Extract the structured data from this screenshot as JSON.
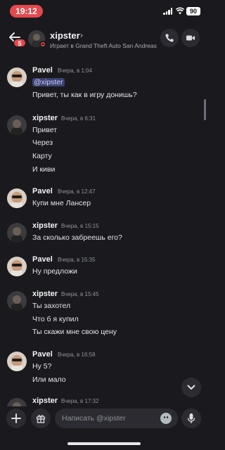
{
  "status_bar": {
    "time": "19:12",
    "battery": "90"
  },
  "header": {
    "back_badge": "5",
    "username": "xipster",
    "chevron": "›",
    "activity": "Играет в Grand Theft Auto San Andreas"
  },
  "messages": [
    {
      "author": "Pavel",
      "time": "Вчера, в 1:04",
      "mention": "@xipster",
      "lines": [
        "Привет, ты как в игру донишь?"
      ]
    },
    {
      "author": "xipster",
      "time": "Вчера, в 6:31",
      "lines": [
        "Привет",
        "Через",
        "Карту",
        "И киви"
      ]
    },
    {
      "author": "Pavel",
      "time": "Вчера, в 12:47",
      "lines": [
        "Купи мне Лансер"
      ]
    },
    {
      "author": "xipster",
      "time": "Вчера, в 15:15",
      "lines": [
        "За сколько забреешь его?"
      ]
    },
    {
      "author": "Pavel",
      "time": "Вчера, в 15:35",
      "lines": [
        "Ну предложи"
      ]
    },
    {
      "author": "xipster",
      "time": "Вчера, в 15:45",
      "lines": [
        "Ты захотел",
        "Что б я купил",
        "Ты скажи мне свою цену"
      ]
    },
    {
      "author": "Pavel",
      "time": "Вчера, в 16:58",
      "lines": [
        "Ну 5?",
        "Или мало"
      ]
    },
    {
      "author": "xipster",
      "time": "Вчера, в 17:32",
      "lines": []
    }
  ],
  "input": {
    "placeholder": "Написать @xipster"
  },
  "icons": {
    "back": "arrow-left-icon",
    "call": "phone-icon",
    "video": "video-camera-icon",
    "jump": "chevron-down-icon",
    "add": "plus-icon",
    "gift": "gift-icon",
    "emoji": "smile-icon",
    "mic": "microphone-icon"
  },
  "colors": {
    "background": "#1a1a1e",
    "badge": "#e5484d",
    "mention_bg": "#3c4270"
  }
}
